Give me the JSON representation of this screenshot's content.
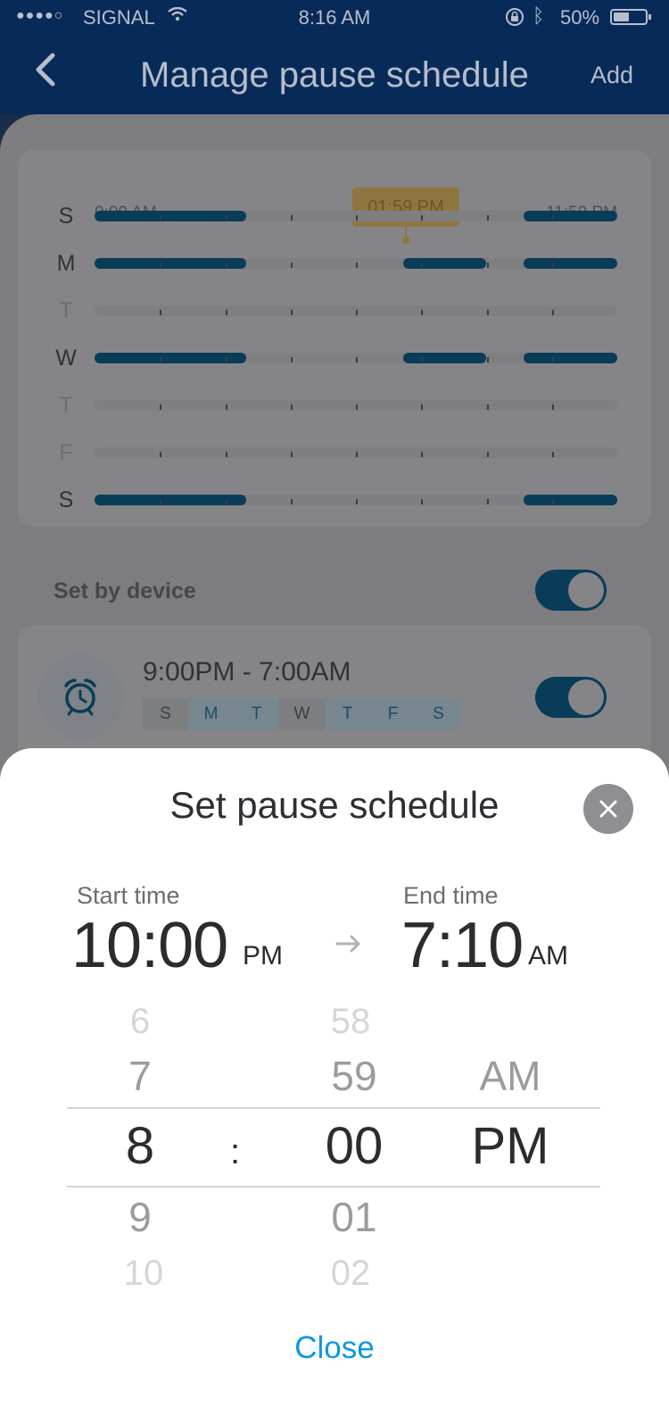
{
  "status_bar": {
    "carrier": "SIGNAL",
    "time": "8:16 AM",
    "battery_percent": "50%",
    "battery_level": 0.5
  },
  "nav": {
    "title": "Manage pause schedule",
    "add_label": "Add"
  },
  "timeline": {
    "start_label": "0:00 AM",
    "end_label": "11:59 PM",
    "current_time": "01:59 PM",
    "current_fraction": 0.58,
    "days": [
      {
        "letter": "S",
        "active": true,
        "segments": [
          [
            0.0,
            0.29
          ],
          [
            0.82,
            1.0
          ]
        ]
      },
      {
        "letter": "M",
        "active": true,
        "segments": [
          [
            0.0,
            0.29
          ],
          [
            0.59,
            0.75
          ],
          [
            0.82,
            1.0
          ]
        ]
      },
      {
        "letter": "T",
        "active": false,
        "segments": []
      },
      {
        "letter": "W",
        "active": true,
        "segments": [
          [
            0.0,
            0.29
          ],
          [
            0.59,
            0.75
          ],
          [
            0.82,
            1.0
          ]
        ]
      },
      {
        "letter": "T",
        "active": false,
        "segments": []
      },
      {
        "letter": "F",
        "active": false,
        "segments": []
      },
      {
        "letter": "S",
        "active": true,
        "segments": [
          [
            0.0,
            0.29
          ],
          [
            0.82,
            1.0
          ]
        ]
      }
    ]
  },
  "set_by_device": {
    "label": "Set by device",
    "enabled": true
  },
  "schedule_item": {
    "time_range": "9:00PM  -  7:00AM",
    "enabled": true,
    "days": [
      {
        "letter": "S",
        "on": false
      },
      {
        "letter": "M",
        "on": true
      },
      {
        "letter": "T",
        "on": true
      },
      {
        "letter": "W",
        "on": false
      },
      {
        "letter": "T",
        "on": true
      },
      {
        "letter": "F",
        "on": true
      },
      {
        "letter": "S",
        "on": true
      }
    ]
  },
  "sheet": {
    "title": "Set pause schedule",
    "start_label": "Start time",
    "start_time": "10:00",
    "start_ampm": "PM",
    "end_label": "End time",
    "end_time": "7:10",
    "end_ampm": "AM",
    "picker": {
      "hours": [
        "6",
        "7",
        "8",
        "9",
        "10"
      ],
      "minutes": [
        "58",
        "59",
        "00",
        "01",
        "02"
      ],
      "ampm": [
        "AM",
        "PM"
      ],
      "separator": ":"
    },
    "close_label": "Close"
  },
  "colors": {
    "accent": "#0c97e4",
    "nav_bg": "#082a59",
    "timeline_bar": "#083c59",
    "now_marker": "#8f7640"
  }
}
